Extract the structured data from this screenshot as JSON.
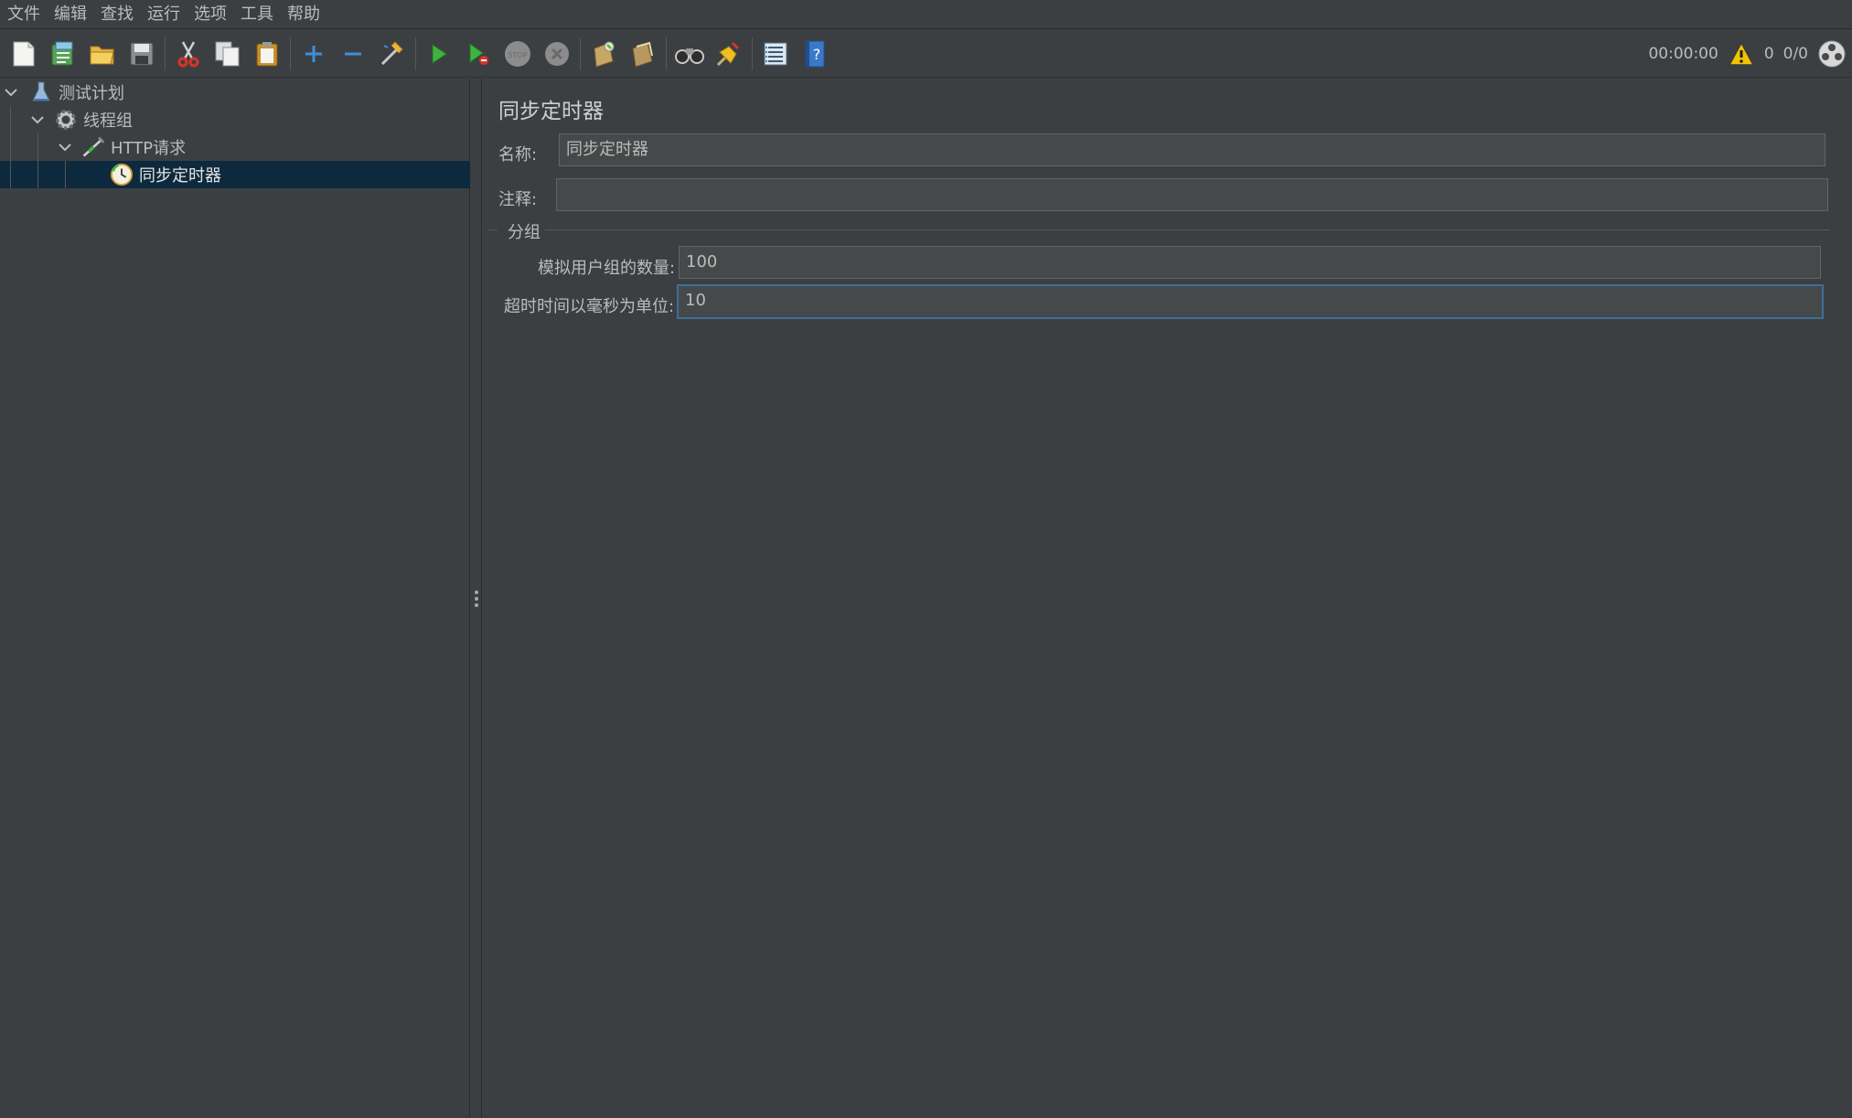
{
  "menu": {
    "items": [
      "文件",
      "编辑",
      "查找",
      "运行",
      "选项",
      "工具",
      "帮助"
    ]
  },
  "toolbar": {
    "buttons": [
      "new-icon",
      "templates-icon",
      "open-icon",
      "save-icon",
      "cut-icon",
      "copy-icon",
      "paste-icon",
      "expand-icon",
      "collapse-icon",
      "toggle-icon",
      "start-icon",
      "start-no-pause-icon",
      "stop-icon",
      "shutdown-icon",
      "clear-icon",
      "clear-all-icon",
      "search-icon",
      "reset-search-icon",
      "function-helper-icon",
      "help-icon"
    ],
    "timer": "00:00:00",
    "warning_count": "0",
    "threads": "0/0"
  },
  "tree": {
    "items": [
      {
        "label": "测试计划",
        "icon": "test-plan-icon",
        "level": 0
      },
      {
        "label": "线程组",
        "icon": "thread-group-icon",
        "level": 1
      },
      {
        "label": "HTTP请求",
        "icon": "http-request-icon",
        "level": 2
      },
      {
        "label": "同步定时器",
        "icon": "timer-icon",
        "level": 3,
        "selected": true
      }
    ]
  },
  "main": {
    "title": "同步定时器",
    "name_label": "名称:",
    "name_value": "同步定时器",
    "comment_label": "注释:",
    "comment_value": "",
    "group_title": "分组",
    "users_label": "模拟用户组的数量:",
    "users_value": "100",
    "timeout_label": "超时时间以毫秒为单位:",
    "timeout_value": "10"
  },
  "colors": {
    "background": "#3c3f41",
    "selection": "#0d293e",
    "input_bg": "#45494a",
    "focus_border": "#3d6f9a"
  }
}
